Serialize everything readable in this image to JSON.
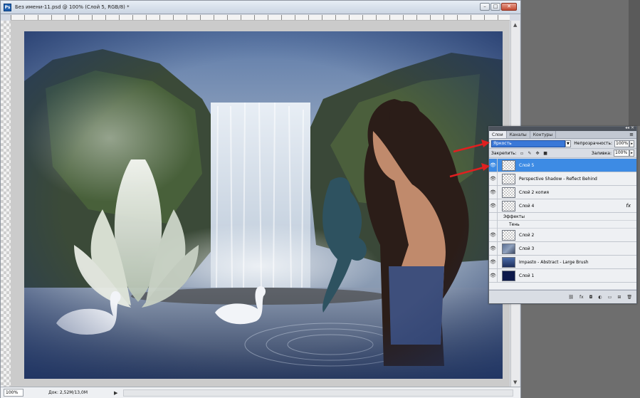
{
  "window": {
    "title": "Без имени-11.psd @ 100% (Слой 5, RGB/8) *",
    "app_icon": "Ps",
    "min_icon": "minimize-icon",
    "max_icon": "maximize-icon",
    "close_icon": "close-icon"
  },
  "status": {
    "zoom": "100%",
    "doc_info": "Док: 2,52M/13,0M"
  },
  "layers_panel": {
    "tabs": [
      {
        "label": "Слои",
        "active": true
      },
      {
        "label": "Каналы",
        "active": false
      },
      {
        "label": "Контуры",
        "active": false
      }
    ],
    "blend_mode": "Яркость",
    "opacity_label": "Непрозрачность:",
    "opacity_value": "100%",
    "lock_label": "Закрепить:",
    "fill_label": "Заливка:",
    "fill_value": "100%",
    "layers": [
      {
        "name": "Слой 5",
        "selected": true,
        "thumb": "transparent"
      },
      {
        "name": "Perspective Shadow - Reflect Behind",
        "selected": false,
        "thumb": "transparent"
      },
      {
        "name": "Слой 2 копия",
        "selected": false,
        "thumb": "transparent"
      },
      {
        "name": "Слой 4",
        "selected": false,
        "thumb": "transparent",
        "fx": "fx"
      },
      {
        "name": "Слой 2",
        "selected": false,
        "thumb": "transparent"
      },
      {
        "name": "Слой 3",
        "selected": false,
        "thumb": "image"
      },
      {
        "name": "Impasto - Abstract - Large Brush",
        "selected": false,
        "thumb": "blue"
      },
      {
        "name": "Слой 1",
        "selected": false,
        "thumb": "navy"
      }
    ],
    "effects_label": "Эффекты",
    "effect_name": "Тень"
  },
  "colors": {
    "accent": "#3d8be4",
    "arrow": "#e02020",
    "blend_select": "#3a78d8"
  }
}
